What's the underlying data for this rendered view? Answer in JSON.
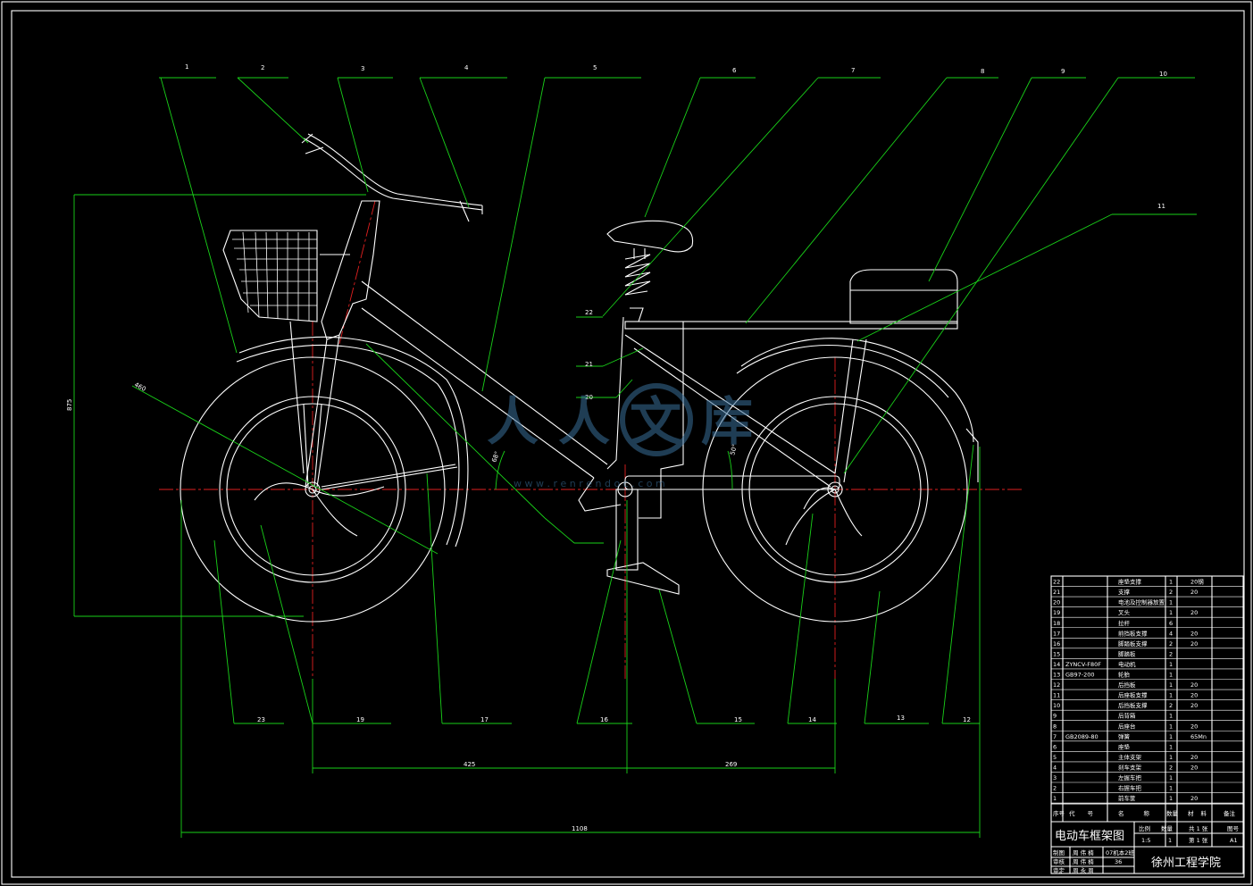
{
  "drawing": {
    "title": "电动车框架图",
    "school": "徐州工程学院",
    "watermark_text": "人人文库",
    "watermark_url": "w w w . r e n r e n d o c . c o m"
  },
  "callouts": [
    "1",
    "2",
    "3",
    "4",
    "5",
    "6",
    "7",
    "8",
    "9",
    "10",
    "11",
    "12",
    "13",
    "14",
    "15",
    "16",
    "17",
    "19",
    "20",
    "21",
    "22",
    "23"
  ],
  "dimensions": {
    "overall_length": "1108",
    "front_to_crank": "425",
    "crank_to_rear": "269",
    "height": "875",
    "wheel": "460",
    "frame_angle_1": "68°",
    "frame_angle_2": "50°"
  },
  "bom": {
    "headers": {
      "seq": "序号",
      "code": "代号",
      "name": "名称",
      "qty": "数量",
      "material": "材料",
      "remark": "备注"
    },
    "rows": [
      {
        "seq": "22",
        "code": "",
        "name": "座垫支撑",
        "qty": "1",
        "material": "20钢"
      },
      {
        "seq": "21",
        "code": "",
        "name": "支撑",
        "qty": "2",
        "material": "20"
      },
      {
        "seq": "20",
        "code": "",
        "name": "电池及控制器放置",
        "qty": "1",
        "material": ""
      },
      {
        "seq": "19",
        "code": "",
        "name": "叉头",
        "qty": "1",
        "material": "20"
      },
      {
        "seq": "18",
        "code": "",
        "name": "拉杆",
        "qty": "6",
        "material": ""
      },
      {
        "seq": "17",
        "code": "",
        "name": "前挡板支撑",
        "qty": "4",
        "material": "20"
      },
      {
        "seq": "16",
        "code": "",
        "name": "脚踏板支撑",
        "qty": "2",
        "material": "20"
      },
      {
        "seq": "15",
        "code": "",
        "name": "脚踏板",
        "qty": "2",
        "material": ""
      },
      {
        "seq": "14",
        "code": "ZYNCV-F80F",
        "qty": "1",
        "name": "电动机",
        "material": ""
      },
      {
        "seq": "13",
        "code": "GB97-200",
        "name": "轮胎",
        "qty": "1",
        "material": ""
      },
      {
        "seq": "12",
        "code": "",
        "name": "后挡板",
        "qty": "1",
        "material": "20"
      },
      {
        "seq": "11",
        "code": "",
        "name": "后座板支撑",
        "qty": "1",
        "material": "20"
      },
      {
        "seq": "10",
        "code": "",
        "name": "后挡板支撑",
        "qty": "2",
        "material": "20"
      },
      {
        "seq": "9",
        "code": "",
        "name": "后背箱",
        "qty": "1",
        "material": ""
      },
      {
        "seq": "8",
        "code": "",
        "name": "后座台",
        "qty": "1",
        "material": "20"
      },
      {
        "seq": "7",
        "code": "GB2089-80",
        "name": "弹簧",
        "qty": "1",
        "material": "65Mn"
      },
      {
        "seq": "6",
        "code": "",
        "name": "座垫",
        "qty": "1",
        "material": ""
      },
      {
        "seq": "5",
        "code": "",
        "name": "主体支架",
        "qty": "1",
        "material": "20"
      },
      {
        "seq": "4",
        "code": "",
        "name": "刹车支架",
        "qty": "2",
        "material": "20"
      },
      {
        "seq": "3",
        "code": "",
        "name": "左握车把",
        "qty": "1",
        "material": ""
      },
      {
        "seq": "2",
        "code": "",
        "name": "右握车把",
        "qty": "1",
        "material": ""
      },
      {
        "seq": "1",
        "code": "",
        "name": "前车筐",
        "qty": "1",
        "material": "20"
      }
    ],
    "title_block": {
      "scale_label": "比例",
      "scale_value": "1:5",
      "qty_label": "数量",
      "qty_value": "1",
      "sheet_total": "共 1 张",
      "sheet_no": "第 1 张",
      "drawing_no_label": "图号",
      "drawing_no": "A1",
      "designer_label": "制图",
      "designer_name": "周 伟 楠",
      "class_value": "07机本2班",
      "checker_label": "审核",
      "checker_name": "周 伟 楠",
      "checker_no": "36",
      "reviewer_label": "审定",
      "reviewer_name": "周 永 周"
    }
  }
}
